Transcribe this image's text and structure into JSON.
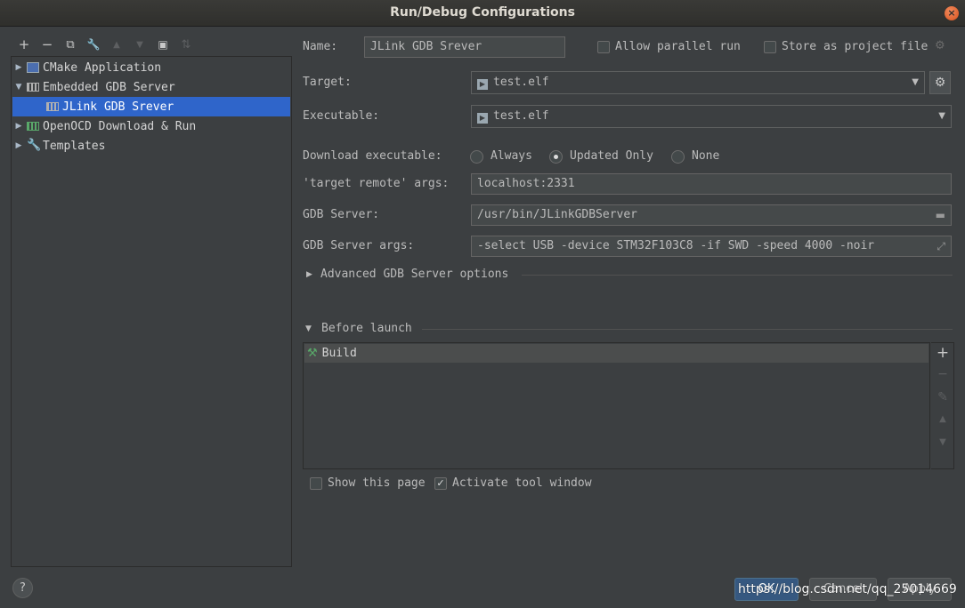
{
  "window": {
    "title": "Run/Debug Configurations",
    "close_symbol": "×"
  },
  "toolbar": {
    "add": "+",
    "remove": "−",
    "copy": "⧉",
    "edit_defaults": "🔧",
    "move_up": "▲",
    "move_down": "▼",
    "folder": "▣",
    "sort": "⇅"
  },
  "tree": {
    "items": [
      {
        "label": "CMake Application",
        "arrow": "▶"
      },
      {
        "label": "Embedded GDB Server",
        "arrow": "▼"
      },
      {
        "label": "JLink GDB Srever"
      },
      {
        "label": "OpenOCD Download & Run",
        "arrow": "▶"
      },
      {
        "label": "Templates",
        "arrow": "▶"
      }
    ]
  },
  "form": {
    "name_label": "Name:",
    "name_value": "JLink GDB Srever",
    "allow_parallel_label": "Allow parallel run",
    "store_project_label": "Store as project file",
    "target_label": "Target:",
    "target_value": "test.elf",
    "executable_label": "Executable:",
    "executable_value": "test.elf",
    "download_label": "Download executable:",
    "download_options": [
      "Always",
      "Updated Only",
      "None"
    ],
    "download_selected": "Updated Only",
    "target_remote_label": "'target remote' args:",
    "target_remote_value": "localhost:2331",
    "gdb_server_label": "GDB Server:",
    "gdb_server_value": "/usr/bin/JLinkGDBServer",
    "gdb_server_args_label": "GDB Server args:",
    "gdb_server_args_value": "-select USB -device STM32F103C8 -if SWD -speed 4000 -noir",
    "advanced_label": "Advanced GDB Server options",
    "before_launch_label": "Before launch",
    "before_launch_items": [
      "Build"
    ],
    "show_page_label": "Show this page",
    "activate_tool_label": "Activate tool window"
  },
  "buttons": {
    "help": "?",
    "ok": "OK",
    "cancel": "Cancel",
    "apply": "Apply"
  },
  "watermark": "https://blog.csdn.net/qq_25014669",
  "colors": {
    "background": "#3c3f41",
    "selection": "#2f65ca",
    "primary_button": "#365880",
    "close_button": "#d9531e"
  }
}
